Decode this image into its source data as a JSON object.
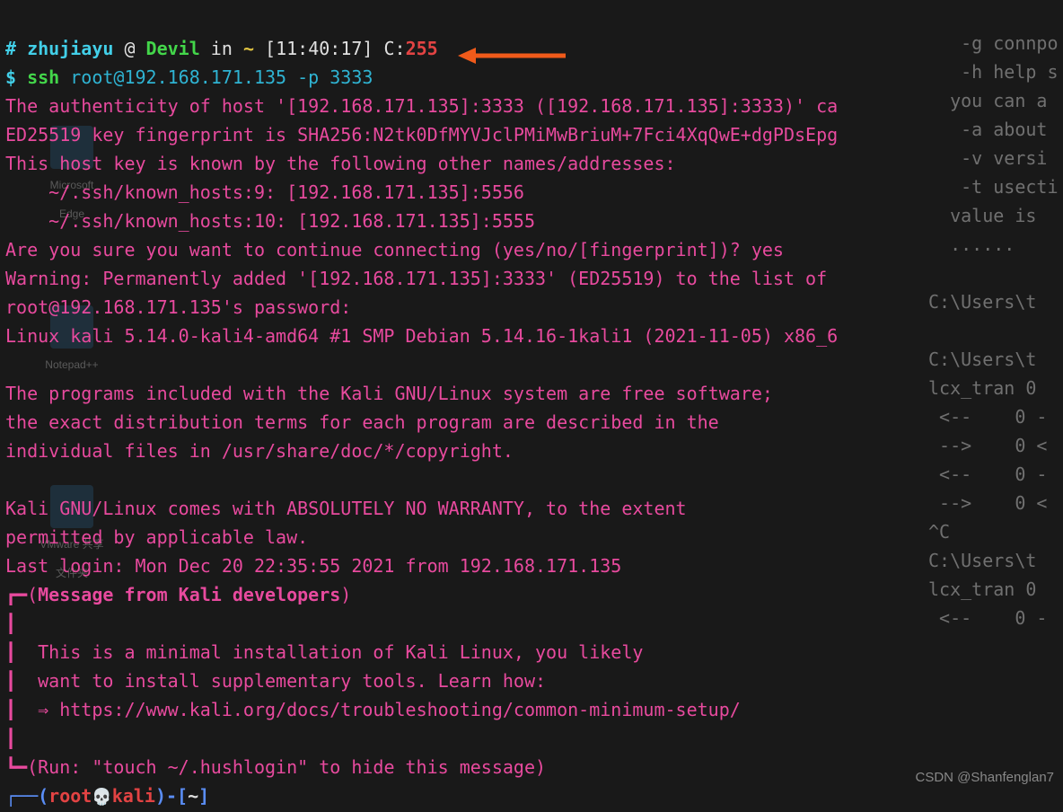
{
  "prompt1": {
    "hash": "# ",
    "user": "zhujiayu",
    "at": " @ ",
    "host": "Devil",
    "in": " in ",
    "path": "~",
    "time": " [11:40:17] ",
    "c": "C:",
    "code": "255"
  },
  "prompt2": {
    "dollar": "$ ",
    "cmd": "ssh ",
    "args": "root@192.168.171.135 -p 3333"
  },
  "out": {
    "l1": "The authenticity of host '[192.168.171.135]:3333 ([192.168.171.135]:3333)' ca",
    "l2": "ED25519 key fingerprint is SHA256:N2tk0DfMYVJclPMiMwBriuM+7Fci4XqQwE+dgPDsEpg",
    "l3": "This host key is known by the following other names/addresses:",
    "l4": "    ~/.ssh/known_hosts:9: [192.168.171.135]:5556",
    "l5": "    ~/.ssh/known_hosts:10: [192.168.171.135]:5555",
    "l6": "Are you sure you want to continue connecting (yes/no/[fingerprint])? yes",
    "l7": "Warning: Permanently added '[192.168.171.135]:3333' (ED25519) to the list of ",
    "l8": "root@192.168.171.135's password:",
    "l9": "Linux kali 5.14.0-kali4-amd64 #1 SMP Debian 5.14.16-1kali1 (2021-11-05) x86_6",
    "b1": "",
    "l10": "The programs included with the Kali GNU/Linux system are free software;",
    "l11": "the exact distribution terms for each program are described in the",
    "l12": "individual files in /usr/share/doc/*/copyright.",
    "b2": "",
    "l13": "Kali GNU/Linux comes with ABSOLUTELY NO WARRANTY, to the extent",
    "l14": "permitted by applicable law.",
    "l15": "Last login: Mon Dec 20 22:35:55 2021 from 192.168.171.135"
  },
  "box": {
    "top_open": "┏━(",
    "title": "Message from Kali developers",
    "top_close": ")",
    "bar": "┃",
    "msg1": "  This is a minimal installation of Kali Linux, you likely",
    "msg2": "  want to install supplementary tools. Learn how:",
    "msg3": "  ⇒ https://www.kali.org/docs/troubleshooting/common-minimum-setup/",
    "bot_open": "┗━(",
    "run": "Run: \"touch ~/.hushlogin\" to hide this message",
    "bot_close": ")"
  },
  "kali_prompt": {
    "open": "┌──(",
    "user": "root",
    "skull": "💀",
    "host": "kali",
    "close": ")-[",
    "tilde": "~",
    "end": "]"
  },
  "bg": {
    "l1": "   -g connpo",
    "l2": "   -h help s",
    "l3": "  you can a",
    "l4": "   -a about",
    "l5": "   -v versi",
    "l6": "   -t usecti",
    "l7": "  value is ",
    "l8": "  ......",
    "l9": "",
    "l10": "C:\\Users\\t",
    "l11": "",
    "l12": "C:\\Users\\t",
    "l13": "lcx_tran 0",
    "l14": " <--    0 -",
    "l15": " -->    0 <",
    "l16": " <--    0 -",
    "l17": " -->    0 <",
    "l18": "^C",
    "l19": "C:\\Users\\t",
    "l20": "lcx_tran 0",
    "l21": " <--    0 -"
  },
  "watermark": "CSDN @Shanfenglan7",
  "icons": {
    "edge": "Microsoft Edge",
    "npp": "Notepad++",
    "vmw": "VMware 共享文件夹"
  }
}
